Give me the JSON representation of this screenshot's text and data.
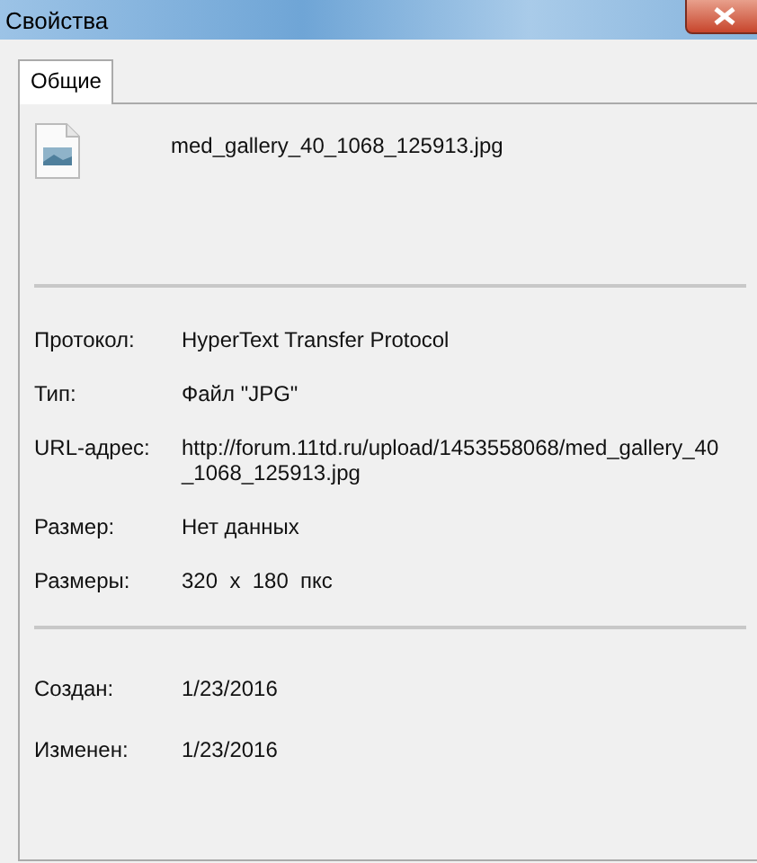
{
  "window": {
    "title": "Свойства"
  },
  "tabs": [
    {
      "label": "Общие",
      "selected": true
    }
  ],
  "file": {
    "name": "med_gallery_40_1068_125913.jpg"
  },
  "groups": [
    {
      "rows": [
        {
          "label": "Протокол:",
          "value": "HyperText Transfer Protocol"
        },
        {
          "label": "Тип:",
          "value": "Файл \"JPG\""
        },
        {
          "label": "URL-адрес:",
          "value": "http://forum.11td.ru/upload/1453558068/med_gallery_40_1068_125913.jpg"
        },
        {
          "label": "Размер:",
          "value": "Нет данных"
        },
        {
          "label": "Размеры:",
          "value": "320  x  180  пкс"
        }
      ]
    },
    {
      "rows": [
        {
          "label": "Создан:",
          "value": "1/23/2016"
        },
        {
          "label": "Изменен:",
          "value": "1/23/2016"
        }
      ]
    }
  ]
}
